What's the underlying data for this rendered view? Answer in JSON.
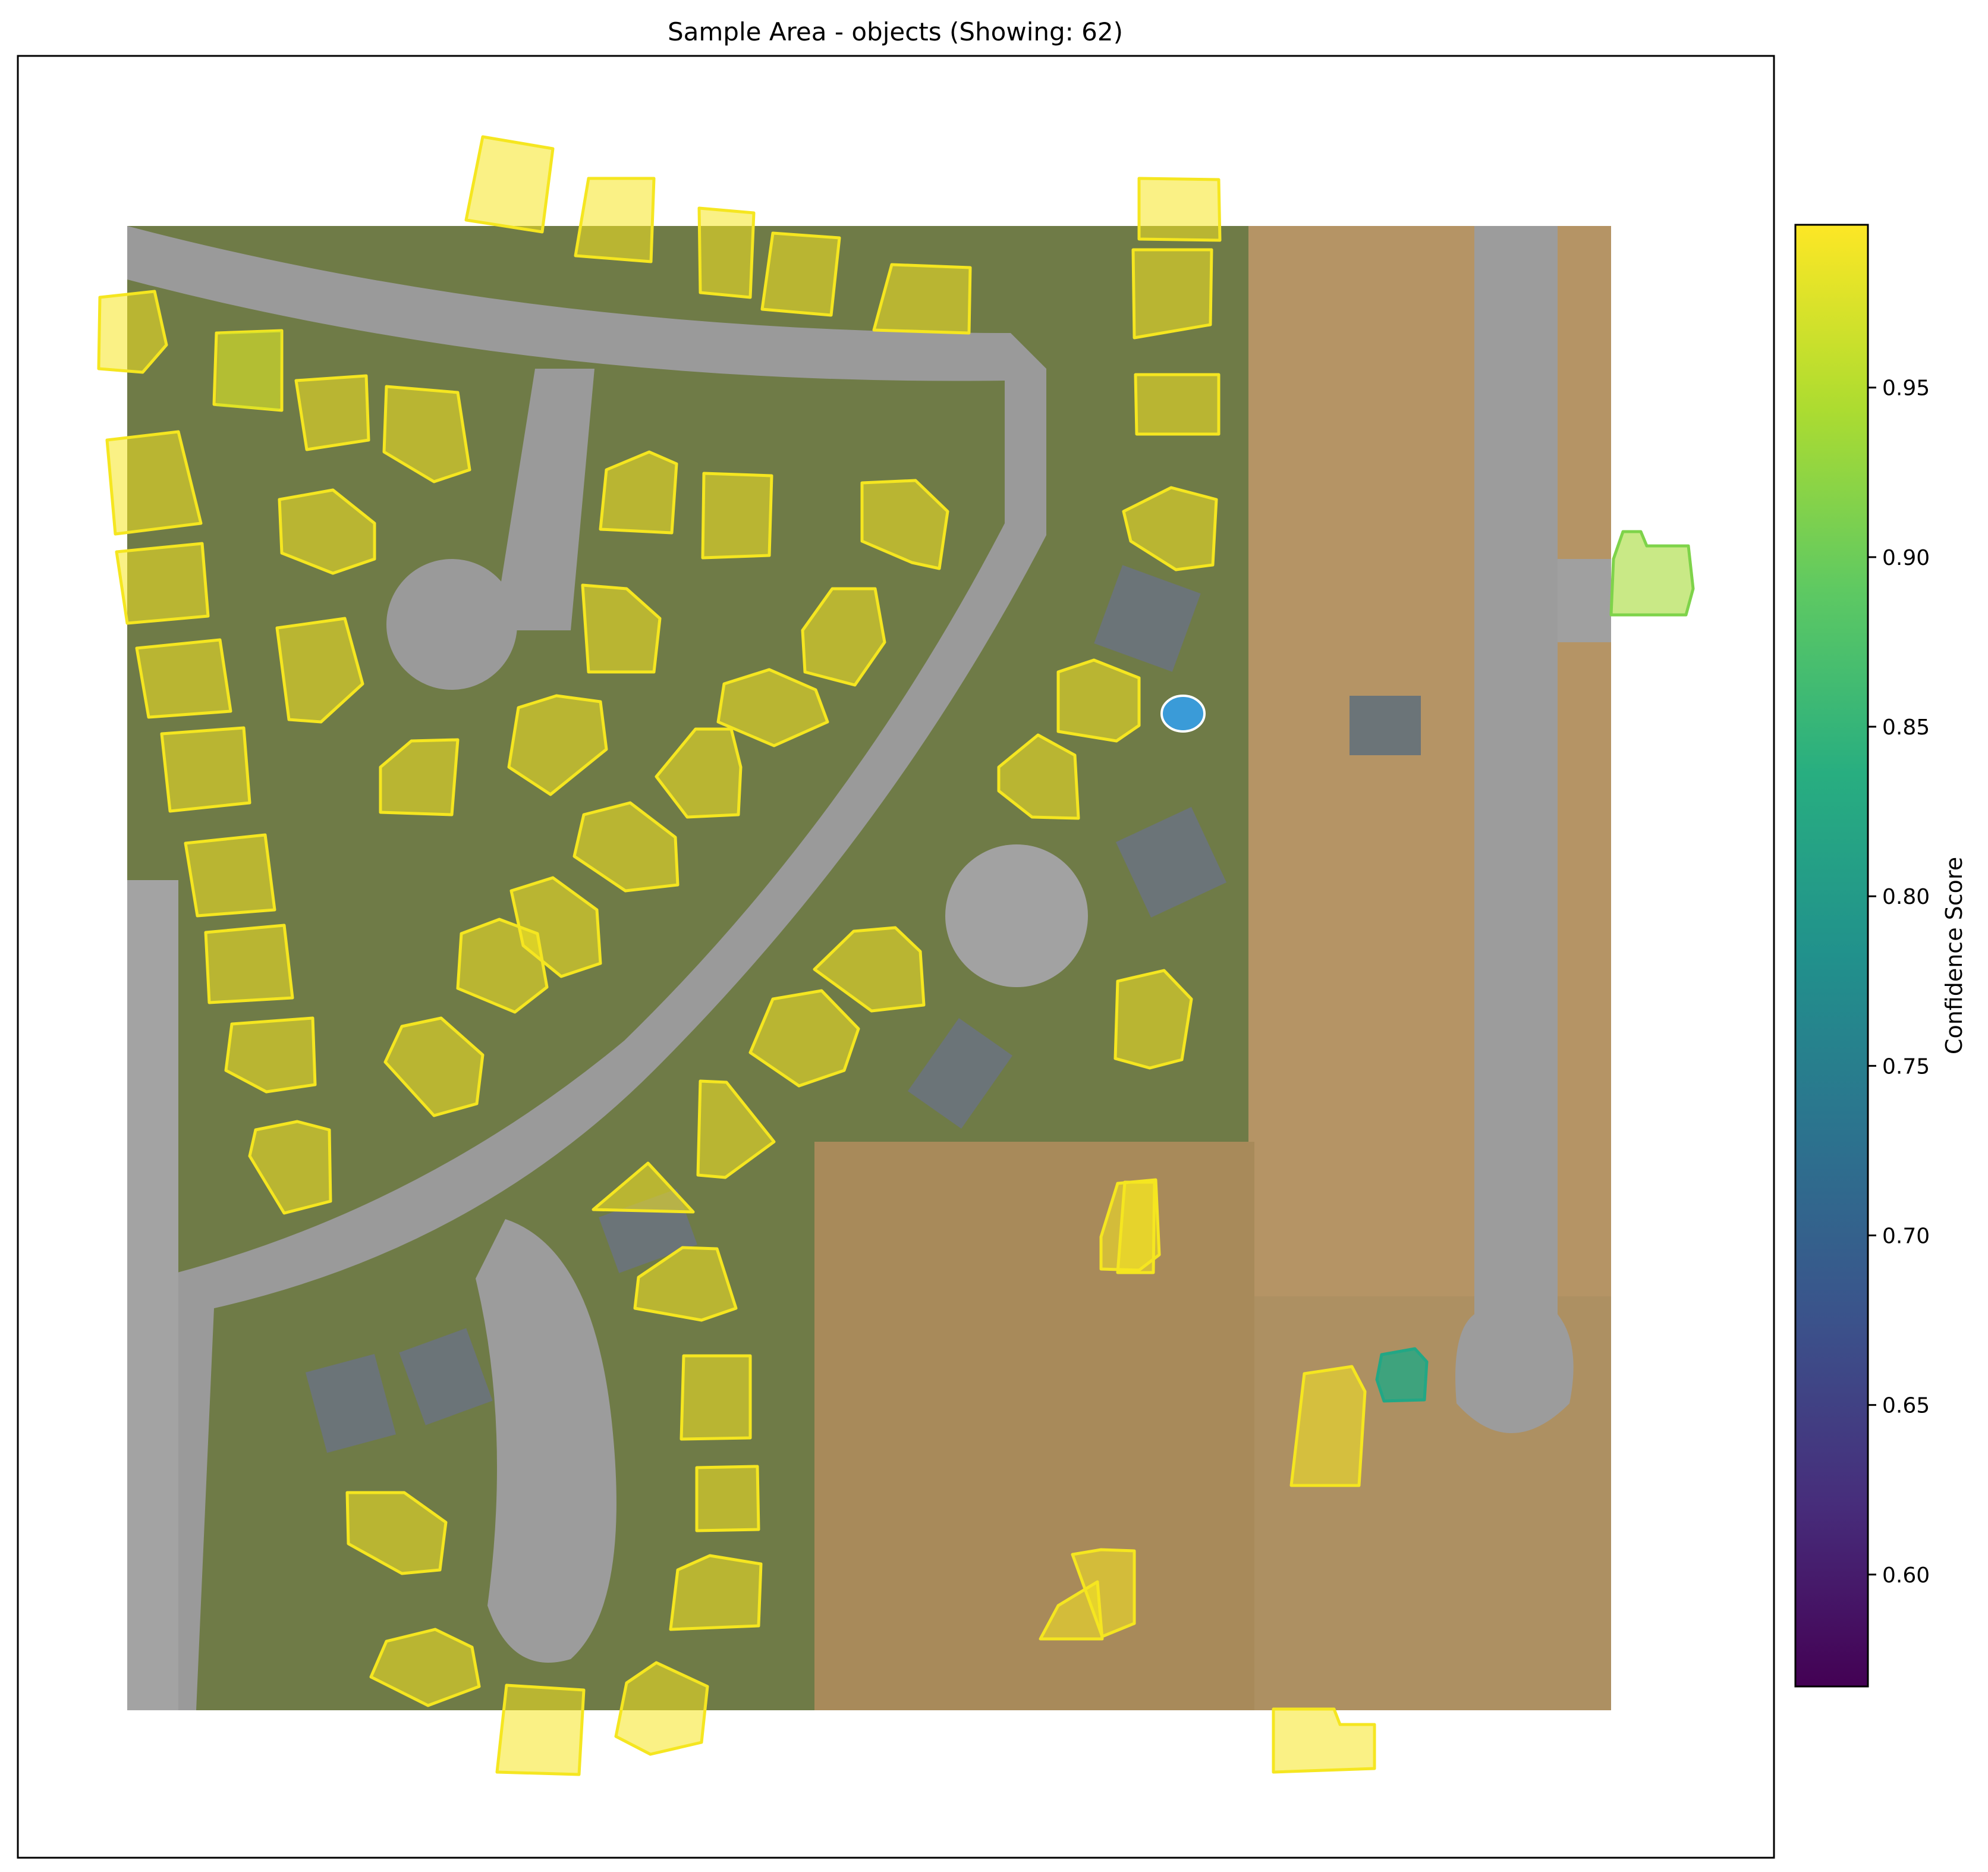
{
  "title": "Sample Area - objects (Showing: 62)",
  "colorbar": {
    "label": "Confidence Score",
    "min": 0.567,
    "max": 0.998,
    "ticks": [
      "0.60",
      "0.65",
      "0.70",
      "0.75",
      "0.80",
      "0.85",
      "0.90",
      "0.95"
    ],
    "tick_values": [
      0.6,
      0.65,
      0.7,
      0.75,
      0.8,
      0.85,
      0.9,
      0.95
    ],
    "colormap": "viridis"
  },
  "colors": {
    "high_conf": "#f5e620",
    "mid_conf": "#a5db36",
    "low_conf": "#22a785",
    "road": "#9a9a9a",
    "ground": "#b89968",
    "lawn": "#7d8a4a",
    "roof_gray": "#6b7478"
  },
  "chart_data": {
    "type": "map_overlay",
    "title": "Sample Area - objects (Showing: 62)",
    "count_shown": 62,
    "colorbar_label": "Confidence Score",
    "colorbar_range": [
      0.567,
      0.998
    ],
    "colorbar_ticks": [
      0.6,
      0.65,
      0.7,
      0.75,
      0.8,
      0.85,
      0.9,
      0.95
    ],
    "detections_by_confidence": {
      "high_about_0.99": 60,
      "about_0.93": 1,
      "about_0.86": 1
    }
  }
}
